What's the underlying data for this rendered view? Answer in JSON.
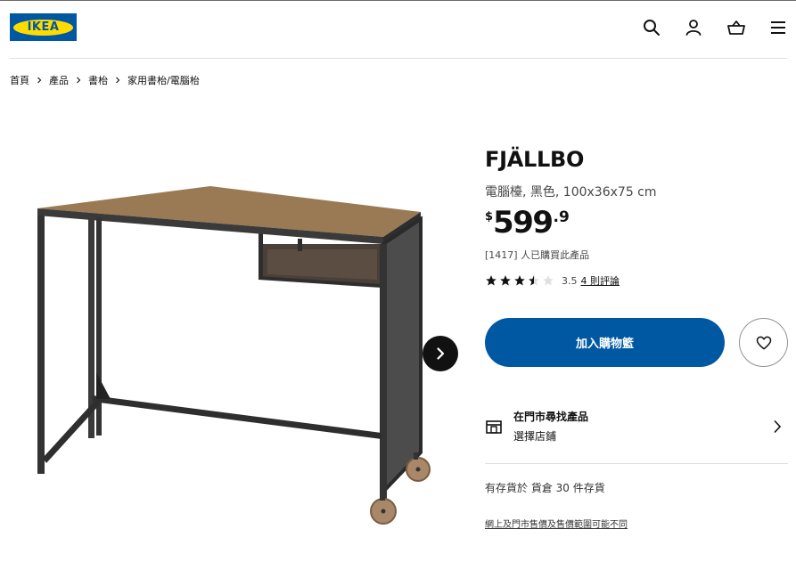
{
  "header": {
    "logo_text": "IKEA",
    "brand_colors": {
      "blue": "#0058a3",
      "yellow": "#ffdb00"
    },
    "icons": [
      "search-icon",
      "account-icon",
      "cart-icon",
      "menu-icon"
    ]
  },
  "breadcrumb": [
    "首頁",
    "產品",
    "書枱",
    "家用書枱/電腦枱"
  ],
  "product": {
    "name": "FJÄLLBO",
    "description": "電腦檯, 黑色, 100x36x75 cm",
    "price": {
      "currency": "$",
      "integer": "599",
      "decimal": ".9"
    },
    "buyers": "[1417] 人已購買此產品",
    "rating": {
      "score": "3.5",
      "stars": 3.5,
      "max": 5,
      "reviews_link": "4 則評論"
    }
  },
  "actions": {
    "add_to_cart": "加入購物籃",
    "wishlist_icon": "heart-icon",
    "accent_color": "#0058a3"
  },
  "store": {
    "title": "在門市尋找產品",
    "subtitle": "選擇店鋪"
  },
  "stock_text": "有存貨於 貨倉 30 件存貨",
  "disclaimer": "網上及門市售價及售價範圍可能不同"
}
